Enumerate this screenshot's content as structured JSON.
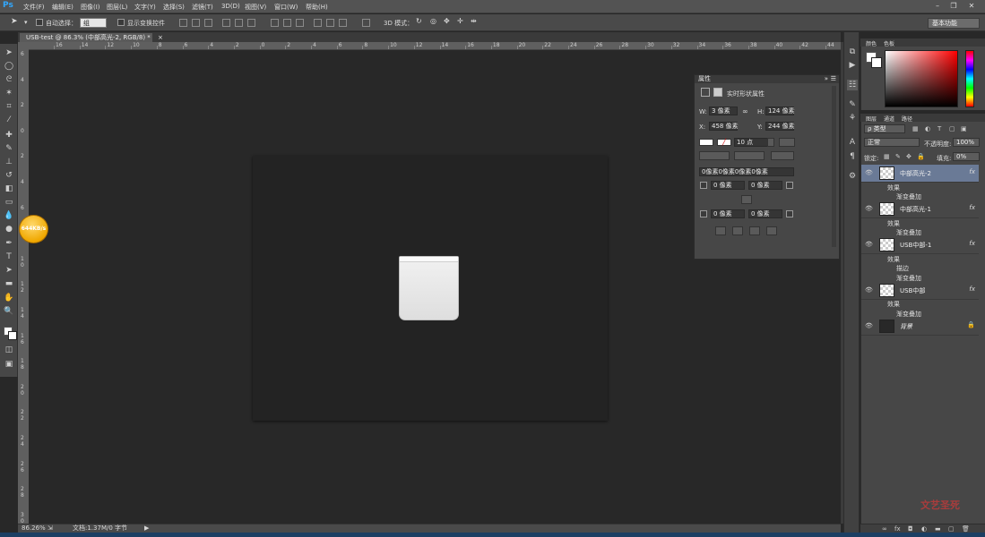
{
  "app": {
    "logo": "Ps"
  },
  "menu": [
    "文件(F)",
    "编辑(E)",
    "图像(I)",
    "图层(L)",
    "文字(Y)",
    "选择(S)",
    "滤镜(T)",
    "3D(D)",
    "视图(V)",
    "窗口(W)",
    "帮助(H)"
  ],
  "options": {
    "auto_select_label": "自动选择：",
    "auto_select_value": "组",
    "show_transform_label": "显示变换控件",
    "mode3d_label": "3D 模式：",
    "workspace": "基本功能"
  },
  "document": {
    "tab_title": "USB-test @ 86.3% (中部高光-2, RGB/8) *",
    "zoom": "86.26%",
    "doc_info": "文档:1.37M/0 字节",
    "ruler_top_labels": [
      "16",
      "14",
      "12",
      "10",
      "8",
      "6",
      "4",
      "2",
      "0",
      "2",
      "4",
      "6",
      "8",
      "10",
      "12",
      "14",
      "16",
      "18",
      "20",
      "22",
      "24",
      "26",
      "28",
      "30",
      "32",
      "34",
      "36",
      "38",
      "40",
      "42",
      "44"
    ],
    "ruler_left_labels": [
      "6",
      "4",
      "2",
      "0",
      "2",
      "4",
      "6",
      "8",
      "1 0",
      "1 2",
      "1 4",
      "1 6",
      "1 8",
      "2 0",
      "2 2",
      "2 4",
      "2 6",
      "2 8",
      "3 0"
    ]
  },
  "overlay": {
    "speed_badge": "644KB/s"
  },
  "properties": {
    "title": "属性",
    "subtitle": "实时形状属性",
    "w_label": "W:",
    "w_value": "3 像素",
    "h_label": "H:",
    "h_value": "124 像素",
    "x_label": "X:",
    "x_value": "458 像素",
    "y_label": "Y:",
    "y_value": "244 像素",
    "stroke_width": "10 点",
    "radius_all": "0像素0像素0像素0像素",
    "radius_tl": "0 像素",
    "radius_tr": "0 像素",
    "radius_bl": "0 像素",
    "radius_br": "0 像素"
  },
  "color_panel": {
    "tabs": [
      "颜色",
      "色板"
    ]
  },
  "layers_panel": {
    "tabs": [
      "图层",
      "通道",
      "路径"
    ],
    "filter": "ρ 类型",
    "blend_mode": "正常",
    "opacity_label": "不透明度:",
    "opacity_value": "100%",
    "lock_label": "锁定:",
    "fill_label": "填充:",
    "fill_value": "0%",
    "fx_label": "fx",
    "layers": [
      {
        "name": "中部高光-2",
        "effects_label": "效果",
        "effects": [
          "渐变叠加"
        ]
      },
      {
        "name": "中部高光-1",
        "effects_label": "效果",
        "effects": [
          "渐变叠加"
        ]
      },
      {
        "name": "USB中部-1",
        "effects_label": "效果",
        "effects": [
          "描边",
          "渐变叠加"
        ]
      },
      {
        "name": "USB中部",
        "effects_label": "效果",
        "effects": [
          "渐变叠加"
        ]
      },
      {
        "name": "背景"
      }
    ]
  },
  "watermark": "文艺圣死"
}
